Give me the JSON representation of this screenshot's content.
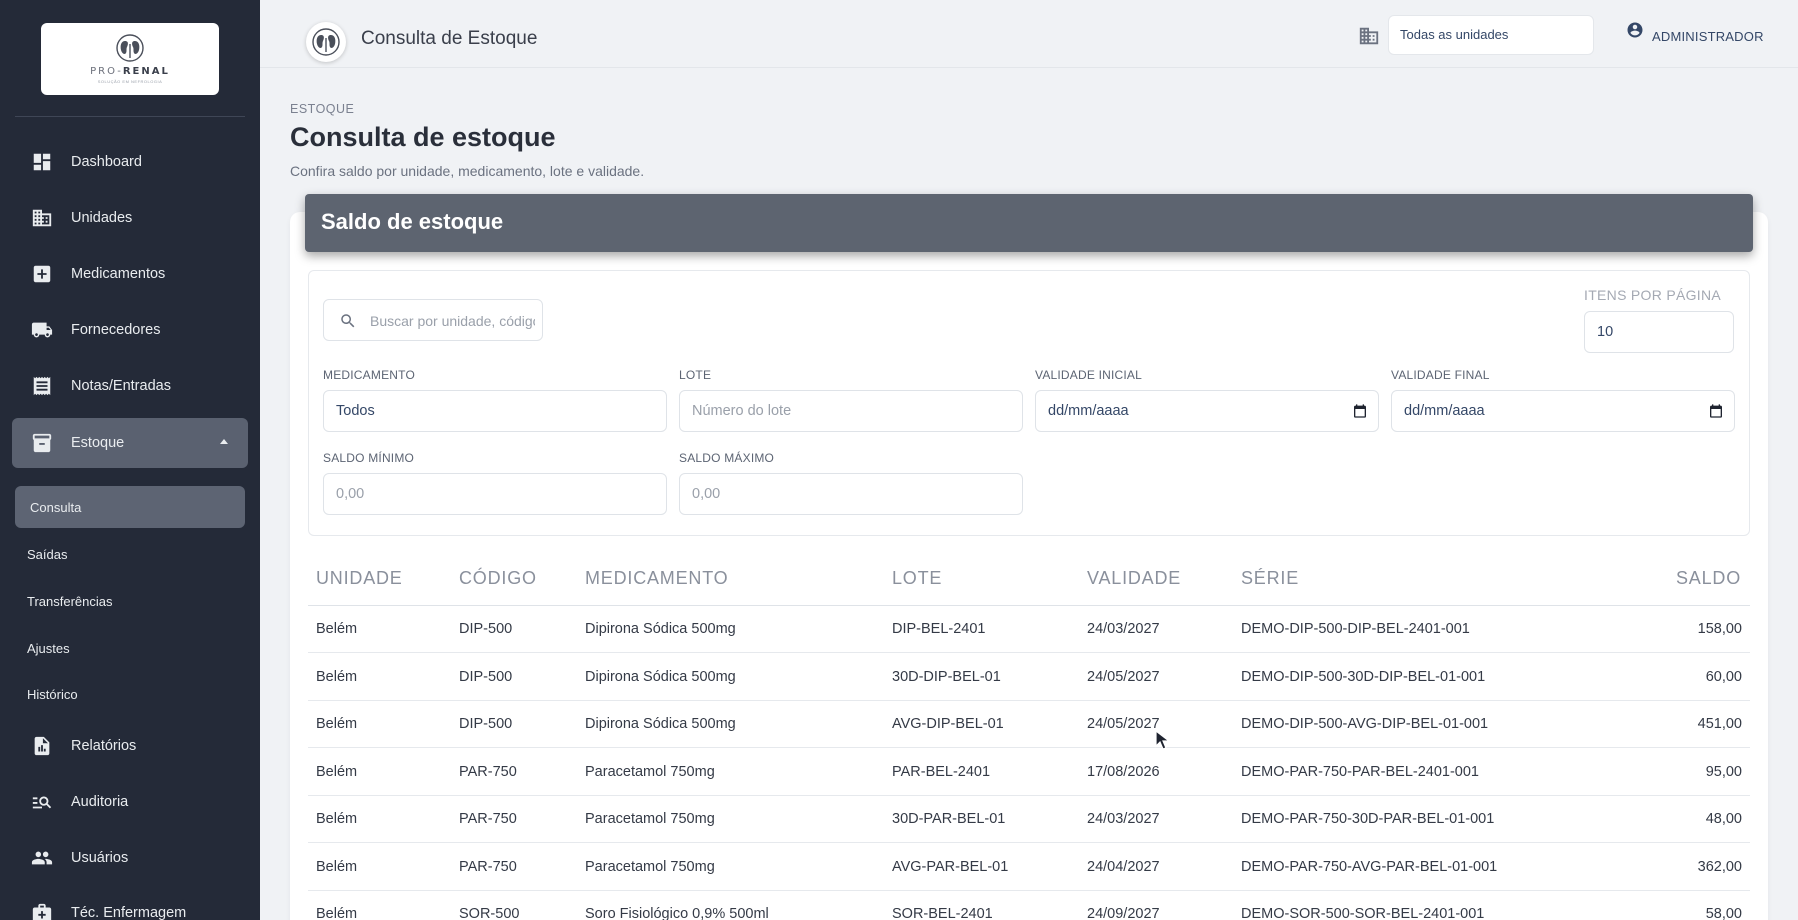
{
  "sidebar": {
    "logo": {
      "brand_prefix": "PRO-",
      "brand_suffix": "RENAL",
      "tagline": "SOLUÇÃO EM NEFROLOGIA"
    },
    "items": [
      {
        "label": "Dashboard",
        "icon": "dashboard-icon"
      },
      {
        "label": "Unidades",
        "icon": "building-icon"
      },
      {
        "label": "Medicamentos",
        "icon": "medical-plus-icon"
      },
      {
        "label": "Fornecedores",
        "icon": "truck-icon"
      },
      {
        "label": "Notas/Entradas",
        "icon": "receipt-icon"
      },
      {
        "label": "Estoque",
        "icon": "archive-icon"
      },
      {
        "label": "Relatórios",
        "icon": "report-icon"
      },
      {
        "label": "Auditoria",
        "icon": "search-list-icon"
      },
      {
        "label": "Usuários",
        "icon": "users-icon"
      },
      {
        "label": "Téc. Enfermagem",
        "icon": "medical-bag-icon"
      }
    ],
    "estoque_sub": [
      "Consulta",
      "Saídas",
      "Transferências",
      "Ajustes",
      "Histórico"
    ]
  },
  "topbar": {
    "title": "Consulta de Estoque",
    "unit_select": "Todas as unidades",
    "user": "ADMINISTRADOR"
  },
  "page": {
    "breadcrumb": "ESTOQUE",
    "title": "Consulta de estoque",
    "subtitle": "Confira saldo por unidade, medicamento, lote e validade."
  },
  "card": {
    "title": "Saldo de estoque"
  },
  "filters": {
    "search_placeholder": "Buscar por unidade, código, medicamento",
    "items_per_page_label": "ITENS POR PÁGINA",
    "items_per_page": "10",
    "medicamento_label": "MEDICAMENTO",
    "medicamento_value": "Todos",
    "lote_label": "LOTE",
    "lote_placeholder": "Número do lote",
    "validade_inicial_label": "VALIDADE INICIAL",
    "validade_inicial_value": "dd/mm/aaaa",
    "validade_final_label": "VALIDADE FINAL",
    "validade_final_value": "dd/mm/aaaa",
    "saldo_minimo_label": "SALDO MÍNIMO",
    "saldo_minimo_placeholder": "0,00",
    "saldo_maximo_label": "SALDO MÁXIMO",
    "saldo_maximo_placeholder": "0,00"
  },
  "table": {
    "columns": [
      "UNIDADE",
      "CÓDIGO",
      "MEDICAMENTO",
      "LOTE",
      "VALIDADE",
      "SÉRIE",
      "SALDO"
    ],
    "rows": [
      [
        "Belém",
        "DIP-500",
        "Dipirona Sódica 500mg",
        "DIP-BEL-2401",
        "24/03/2027",
        "DEMO-DIP-500-DIP-BEL-2401-001",
        "158,00"
      ],
      [
        "Belém",
        "DIP-500",
        "Dipirona Sódica 500mg",
        "30D-DIP-BEL-01",
        "24/05/2027",
        "DEMO-DIP-500-30D-DIP-BEL-01-001",
        "60,00"
      ],
      [
        "Belém",
        "DIP-500",
        "Dipirona Sódica 500mg",
        "AVG-DIP-BEL-01",
        "24/05/2027",
        "DEMO-DIP-500-AVG-DIP-BEL-01-001",
        "451,00"
      ],
      [
        "Belém",
        "PAR-750",
        "Paracetamol 750mg",
        "PAR-BEL-2401",
        "17/08/2026",
        "DEMO-PAR-750-PAR-BEL-2401-001",
        "95,00"
      ],
      [
        "Belém",
        "PAR-750",
        "Paracetamol 750mg",
        "30D-PAR-BEL-01",
        "24/03/2027",
        "DEMO-PAR-750-30D-PAR-BEL-01-001",
        "48,00"
      ],
      [
        "Belém",
        "PAR-750",
        "Paracetamol 750mg",
        "AVG-PAR-BEL-01",
        "24/04/2027",
        "DEMO-PAR-750-AVG-PAR-BEL-01-001",
        "362,00"
      ],
      [
        "Belém",
        "SOR-500",
        "Soro Fisiológico 0,9% 500ml",
        "SOR-BEL-2401",
        "24/09/2027",
        "DEMO-SOR-500-SOR-BEL-2401-001",
        "58,00"
      ]
    ]
  }
}
